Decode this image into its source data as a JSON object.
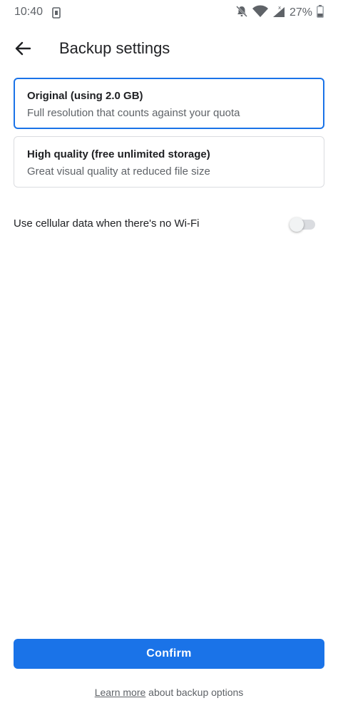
{
  "status_bar": {
    "time": "10:40",
    "battery_percent": "27%",
    "icons": [
      "sim-card-icon",
      "bell-off-icon",
      "wifi-icon",
      "signal-icon",
      "battery-icon"
    ]
  },
  "header": {
    "back_icon": "arrow-left-icon",
    "title": "Backup settings"
  },
  "options": [
    {
      "title": "Original (using 2.0 GB)",
      "description": "Full resolution that counts against your quota",
      "selected": true
    },
    {
      "title": "High quality (free unlimited storage)",
      "description": "Great visual quality at reduced file size",
      "selected": false
    }
  ],
  "cellular": {
    "label": "Use cellular data when there's no Wi-Fi",
    "enabled": false
  },
  "confirm": {
    "label": "Confirm"
  },
  "footer": {
    "link_text": "Learn more",
    "rest_text": " about backup options"
  },
  "colors": {
    "accent": "#1a73e8",
    "text_primary": "#202124",
    "text_secondary": "#5f6368",
    "border": "#dadce0"
  }
}
